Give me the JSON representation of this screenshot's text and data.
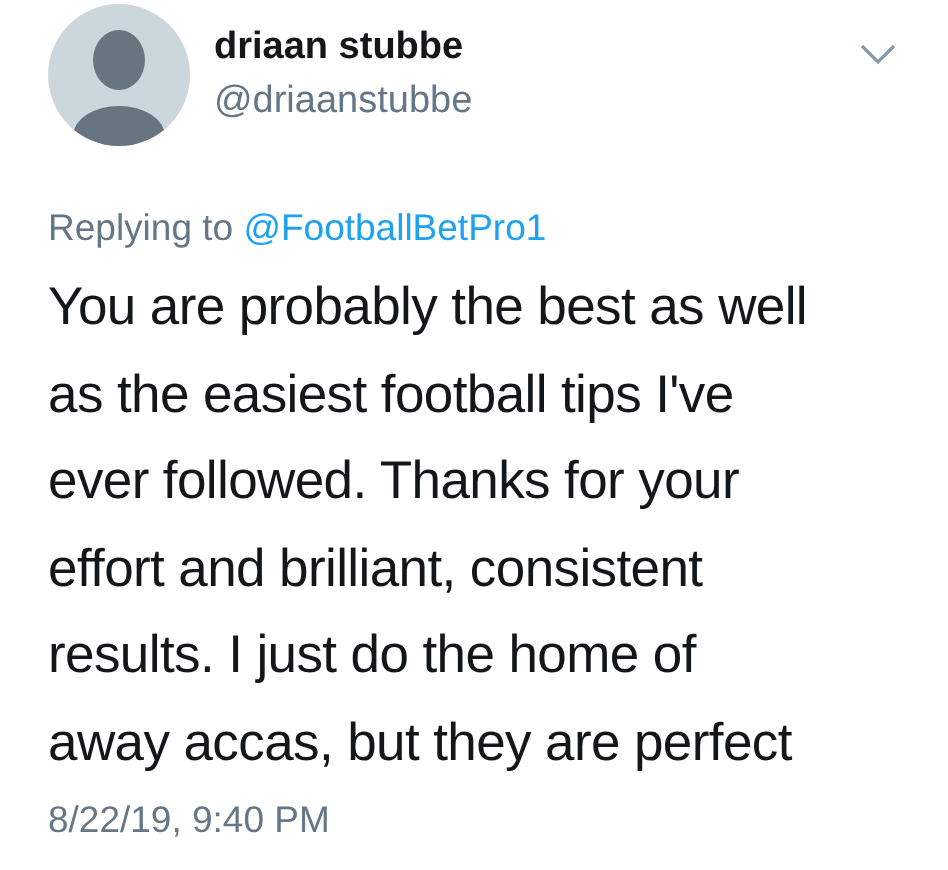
{
  "author": {
    "name": "driaan stubbe",
    "handle": "@driaanstubbe"
  },
  "reply": {
    "prefix": "Replying to",
    "mention": "@FootballBetPro1"
  },
  "text": "You are probably the best as well\nas the easiest football tips I've\never followed. Thanks for your\neffort and brilliant, consistent\nresults. I just do the home of\naway accas, but they are perfect",
  "timestamp": "8/22/19, 9:40 PM"
}
